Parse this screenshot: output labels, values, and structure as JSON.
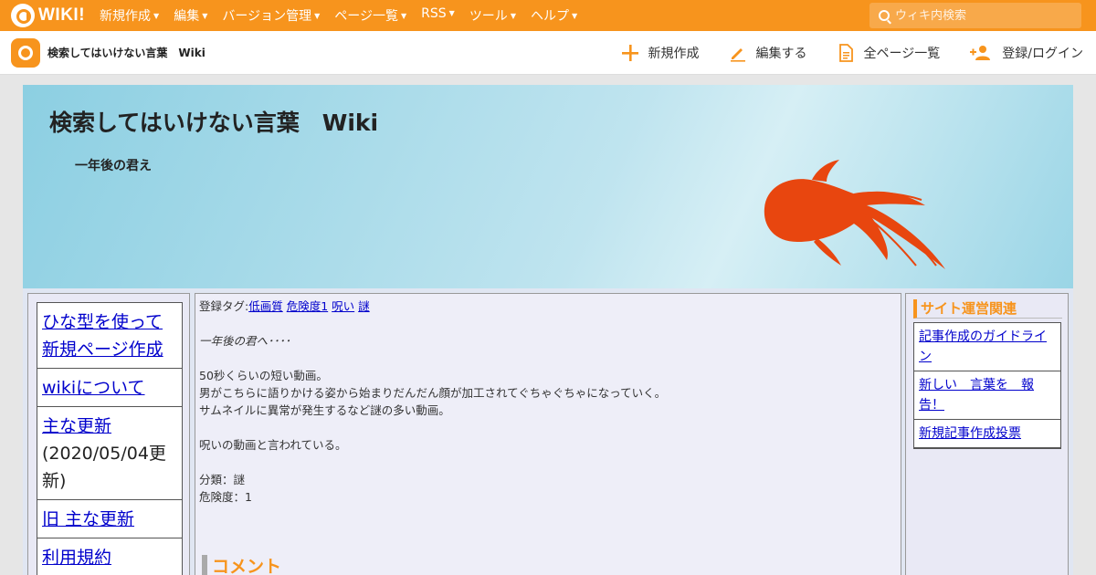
{
  "topbar": {
    "logo_text": "WIKI!",
    "nav": [
      "新規作成",
      "編集",
      "バージョン管理",
      "ページ一覧",
      "RSS",
      "ツール",
      "ヘルプ"
    ],
    "search_placeholder": "ウィキ内検索"
  },
  "header": {
    "site_name": "検索してはいけない言葉　Wiki",
    "actions": {
      "new": "新規作成",
      "edit": "編集する",
      "all_pages": "全ページ一覧",
      "login": "登録/ログイン"
    }
  },
  "banner": {
    "title": "検索してはいけない言葉　Wiki",
    "subtitle": "一年後の君え"
  },
  "left_menu": [
    {
      "label": "ひな型を使って新規ページ作成",
      "note": ""
    },
    {
      "label": "wikiについて",
      "note": ""
    },
    {
      "label": "主な更新",
      "note": "(2020/05/04更新)"
    },
    {
      "label": "旧 主な更新",
      "note": ""
    },
    {
      "label": "利用規約",
      "note": ""
    }
  ],
  "article": {
    "tags_label": "登録タグ:",
    "tags": [
      "低画質",
      "危険度1",
      "呪い",
      "謎"
    ],
    "line_title": "一年後の君へ････",
    "lines": [
      "50秒くらいの短い動画。",
      "男がこちらに語りかける姿から始まりだんだん顔が加工されてぐちゃぐちゃになっていく。",
      "サムネイルに異常が発生するなど謎の多い動画。"
    ],
    "curse_line": "呪いの動画と言われている。",
    "category": "分類：謎",
    "danger": "危険度：1",
    "comment_heading": "コメント"
  },
  "right_menu": {
    "heading": "サイト運営関連",
    "guideline": "記事作成のガイドライン",
    "report": "新しい　言葉を　報告！",
    "vote": "新規記事作成投票"
  },
  "colors": {
    "accent": "#f7941d",
    "link": "#0000cc"
  }
}
